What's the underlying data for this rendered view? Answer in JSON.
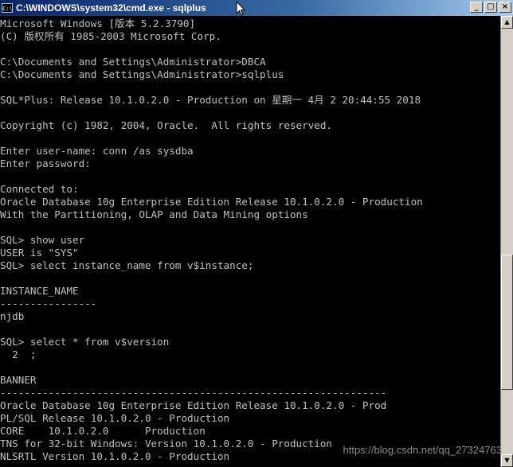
{
  "window": {
    "title": "C:\\WINDOWS\\system32\\cmd.exe - sqlplus",
    "app_icon": "C:\\",
    "controls": {
      "minimize": "_",
      "maximize": "□",
      "close": "×"
    }
  },
  "console": {
    "lines": [
      "Microsoft Windows [版本 5.2.3790]",
      "(C) 版权所有 1985-2003 Microsoft Corp.",
      "",
      "C:\\Documents and Settings\\Administrator>DBCA",
      "C:\\Documents and Settings\\Administrator>sqlplus",
      "",
      "SQL*Plus: Release 10.1.0.2.0 - Production on 星期一 4月 2 20:44:55 2018",
      "",
      "Copyright (c) 1982, 2004, Oracle.  All rights reserved.",
      "",
      "Enter user-name: conn /as sysdba",
      "Enter password:",
      "",
      "Connected to:",
      "Oracle Database 10g Enterprise Edition Release 10.1.0.2.0 - Production",
      "With the Partitioning, OLAP and Data Mining options",
      "",
      "SQL> show user",
      "USER is \"SYS\"",
      "SQL> select instance_name from v$instance;",
      "",
      "INSTANCE_NAME",
      "----------------",
      "njdb",
      "",
      "SQL> select * from v$version",
      "  2  ;",
      "",
      "BANNER",
      "----------------------------------------------------------------",
      "Oracle Database 10g Enterprise Edition Release 10.1.0.2.0 - Prod",
      "PL/SQL Release 10.1.0.2.0 - Production",
      "CORE    10.1.0.2.0      Production",
      "TNS for 32-bit Windows: Version 10.1.0.2.0 - Production",
      "NLSRTL Version 10.1.0.2.0 - Production"
    ]
  },
  "scrollbar": {
    "up_arrow": "▲",
    "down_arrow": "▼"
  },
  "watermark": "https://blog.csdn.net/qq_27324763",
  "colors": {
    "console_bg": "#000000",
    "console_text": "#c0c0c0",
    "titlebar_start": "#0a246a",
    "titlebar_end": "#a6caf0"
  },
  "icons": [
    "cmd-app-icon",
    "mouse-cursor-icon",
    "minimize-icon",
    "maximize-icon",
    "close-icon",
    "scroll-up-icon",
    "scroll-down-icon"
  ]
}
